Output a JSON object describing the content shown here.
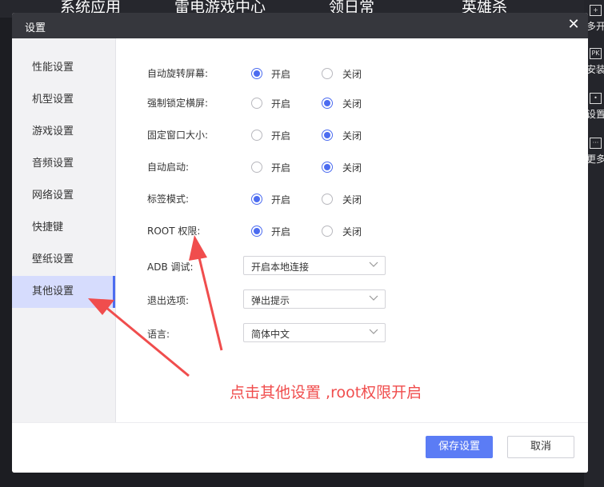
{
  "background": {
    "tabs": [
      "系统应用",
      "雷电游戏中心",
      "领日常",
      "英雄杀"
    ],
    "right_bar": [
      {
        "label": "多开",
        "icon": "plus-icon"
      },
      {
        "label": "安装",
        "icon": "apk-icon"
      },
      {
        "label": "设置",
        "icon": "settings-icon"
      },
      {
        "label": "更多",
        "icon": "more-icon"
      }
    ]
  },
  "dialog": {
    "title": "设置",
    "close_symbol": "✕"
  },
  "sidebar": {
    "items": [
      {
        "label": "性能设置"
      },
      {
        "label": "机型设置"
      },
      {
        "label": "游戏设置"
      },
      {
        "label": "音频设置"
      },
      {
        "label": "网络设置"
      },
      {
        "label": "快捷键"
      },
      {
        "label": "壁纸设置"
      },
      {
        "label": "其他设置",
        "active": true
      }
    ]
  },
  "settings": {
    "on_label": "开启",
    "off_label": "关闭",
    "rows": [
      {
        "label": "自动旋转屏幕:",
        "value": "on"
      },
      {
        "label": "强制锁定横屏:",
        "value": "off"
      },
      {
        "label": "固定窗口大小:",
        "value": "off"
      },
      {
        "label": "自动启动:",
        "value": "off"
      },
      {
        "label": "标签模式:",
        "value": "on"
      },
      {
        "label": "ROOT 权限:",
        "value": "on"
      }
    ],
    "selects": [
      {
        "label": "ADB 调试:",
        "value": "开启本地连接"
      },
      {
        "label": "退出选项:",
        "value": "弹出提示"
      },
      {
        "label": "语言:",
        "value": "简体中文"
      }
    ]
  },
  "footer": {
    "save_label": "保存设置",
    "cancel_label": "取消"
  },
  "annotation": {
    "text": "点击其他设置 ,root权限开启",
    "color": "#f04d4d"
  },
  "colors": {
    "accent": "#4c6cf0",
    "primary_button": "#5b7cf5",
    "sidebar_active": "#d6dcfd",
    "header": "#36373d"
  }
}
